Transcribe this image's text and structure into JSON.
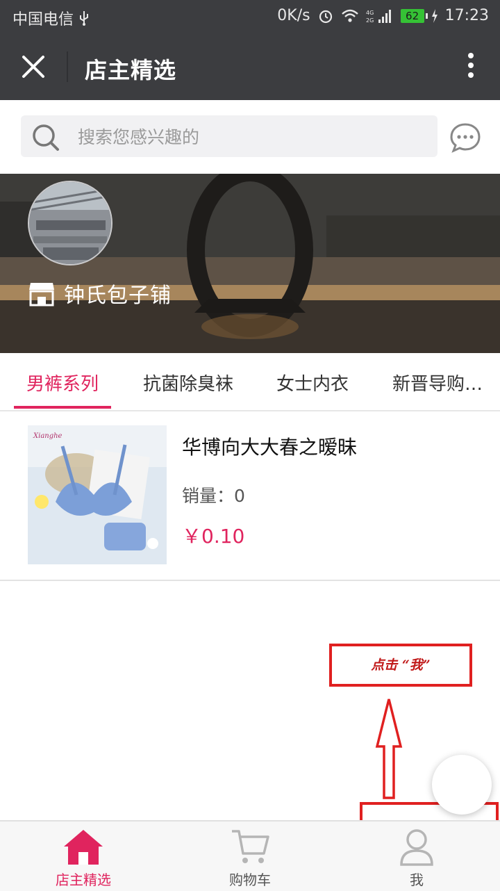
{
  "status_bar": {
    "carrier": "中国电信",
    "usb_icon": "usb-icon",
    "net_speed": "0K/s",
    "battery_level": "62",
    "time": "17:23"
  },
  "title_bar": {
    "title": "店主精选",
    "close_icon": "close-icon",
    "more_icon": "more-vertical-icon"
  },
  "search": {
    "placeholder": "搜索您感兴趣的",
    "icon": "search-icon",
    "chat_icon": "chat-bubble-icon"
  },
  "shop": {
    "name": "钟氏包子铺",
    "icon": "store-icon"
  },
  "tabs": [
    {
      "label": "男裤系列",
      "active": true
    },
    {
      "label": "抗菌除臭袜",
      "active": false
    },
    {
      "label": "女士内衣",
      "active": false
    },
    {
      "label": "新晋导购…",
      "active": false
    }
  ],
  "products": [
    {
      "name": "华博向大大春之暧昧",
      "sales_label": "销量：",
      "sales_value": "0",
      "price": "￥0.10"
    }
  ],
  "annotation": {
    "text": "点击  “我”"
  },
  "bottom_nav": [
    {
      "label": "店主精选",
      "icon": "home-icon",
      "active": true
    },
    {
      "label": "购物车",
      "icon": "cart-icon",
      "active": false
    },
    {
      "label": "我",
      "icon": "user-icon",
      "active": false
    }
  ],
  "colors": {
    "accent": "#e0245e",
    "header": "#3c3d40",
    "annotation_red": "#e02020"
  }
}
